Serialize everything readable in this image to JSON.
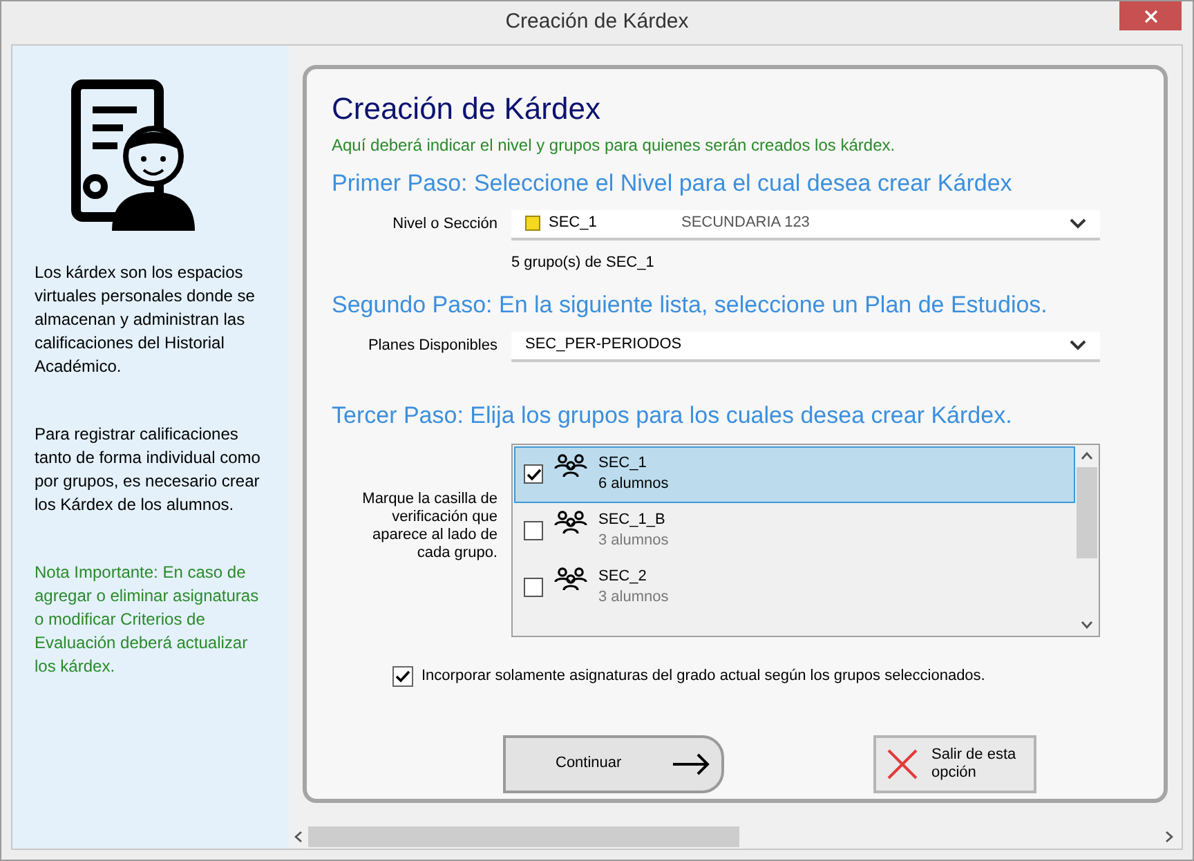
{
  "window": {
    "title": "Creación de Kárdex"
  },
  "sidebar": {
    "paragraphs": [
      {
        "kind": "info",
        "text": "Los kárdex son los espacios virtuales personales donde se almacenan y administran las calificaciones del Historial Académico."
      },
      {
        "kind": "info",
        "text": "Para registrar calificaciones tanto de forma individual como por grupos, es necesario crear los Kárdex de los alumnos."
      },
      {
        "kind": "note",
        "text": "Nota Importante: En caso de agregar o eliminar asignaturas o modificar Criterios de Evaluación deberá actualizar los kárdex."
      }
    ]
  },
  "heading": "Creación de Kárdex",
  "subtitle": "Aquí deberá indicar el nivel y grupos para quienes serán creados los kárdex.",
  "step_1": {
    "title": "Primer Paso:  Seleccione el Nivel para el cual desea crear Kárdex",
    "label": "Nivel o Sección",
    "value": "SEC_1",
    "description": "SECUNDARIA 123",
    "info": "5 grupo(s) de SEC_1"
  },
  "step_2": {
    "title": "Segundo Paso: En la siguiente lista, seleccione un Plan de Estudios.",
    "label": "Planes Disponibles",
    "value": "SEC_PER-PERIODOS"
  },
  "step_3": {
    "title": "Tercer Paso: Elija los grupos para los cuales desea crear Kárdex.",
    "hint": "Marque la casilla de verificación que aparece al lado de cada grupo.",
    "groups": [
      {
        "name": "SEC_1",
        "count": "6 alumnos",
        "checked": true,
        "selected": true
      },
      {
        "name": "SEC_1_B",
        "count": "3 alumnos",
        "checked": false,
        "selected": false
      },
      {
        "name": "SEC_2",
        "count": "3 alumnos",
        "checked": false,
        "selected": false
      }
    ]
  },
  "option": {
    "label": "Incorporar solamente asignaturas del grado actual según los grupos seleccionados.",
    "checked": true
  },
  "buttons": [
    {
      "kind": "continue",
      "label": "Continuar"
    },
    {
      "kind": "exit",
      "label": "Salir de esta opción"
    }
  ]
}
